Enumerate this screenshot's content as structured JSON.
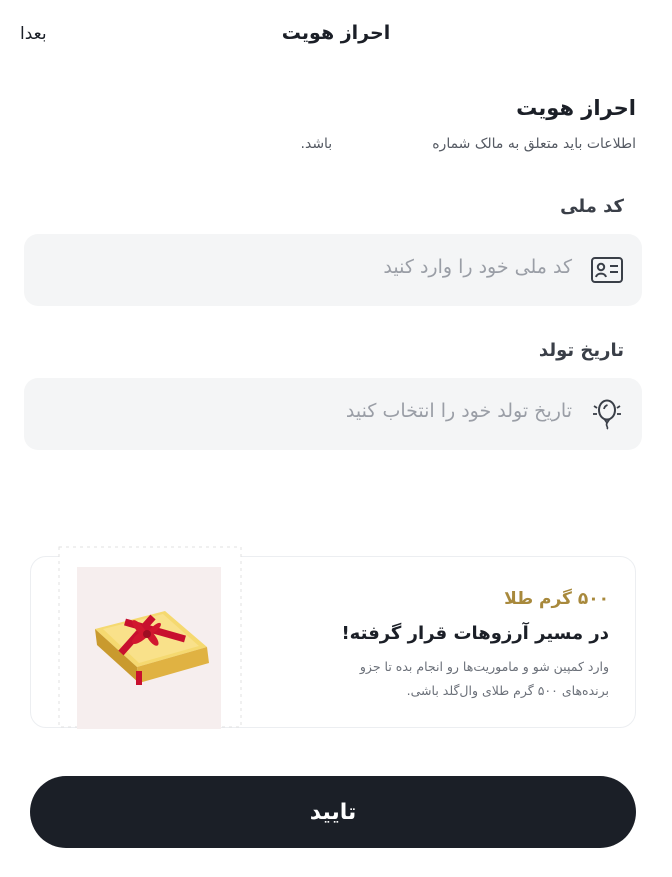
{
  "header": {
    "title": "احراز هویت",
    "later_label": "بعدا"
  },
  "intro": {
    "heading": "احراز هویت",
    "subtitle_part1": "اطلاعات باید متعلق به مالک شماره",
    "subtitle_part2": "باشد."
  },
  "form": {
    "national_id": {
      "label": "کد ملی",
      "placeholder": "کد ملی خود را وارد کنید",
      "icon": "id-card-icon"
    },
    "birth_date": {
      "label": "تاریخ تولد",
      "placeholder": "تاریخ تولد خود را انتخاب کنید",
      "icon": "balloon-icon"
    }
  },
  "promo": {
    "amount": "۵۰۰ گرم طلا",
    "title": "در مسیر آرزوهات قرار گرفته!",
    "description": "وارد کمپین شو و ماموریت‌ها رو انجام بده تا جزو برنده‌های ۵۰۰ گرم طلای وال‌گلد باشی.",
    "image": "gold-bar-with-red-ribbon"
  },
  "actions": {
    "confirm_label": "تایید"
  },
  "colors": {
    "primary": "#1b1f27",
    "gold": "#a8893c",
    "field_bg": "#f4f5f6"
  }
}
